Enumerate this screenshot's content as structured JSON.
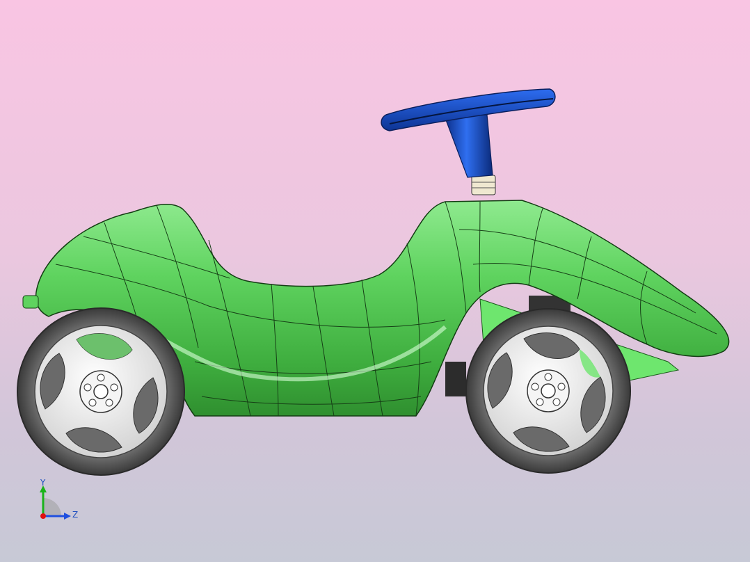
{
  "viewport": {
    "background_top": "#f9c5e3",
    "background_bottom": "#c7c9d6"
  },
  "model": {
    "body_color": "#5fd35f",
    "steering_color": "#1247c9",
    "tire_color": "#4a4a4a",
    "rim_color": "#f2f2f2"
  },
  "triad": {
    "y_label": "Y",
    "z_label": "Z",
    "y_color": "#19b319",
    "z_color": "#1f4fdf",
    "x_color": "#e01010"
  }
}
